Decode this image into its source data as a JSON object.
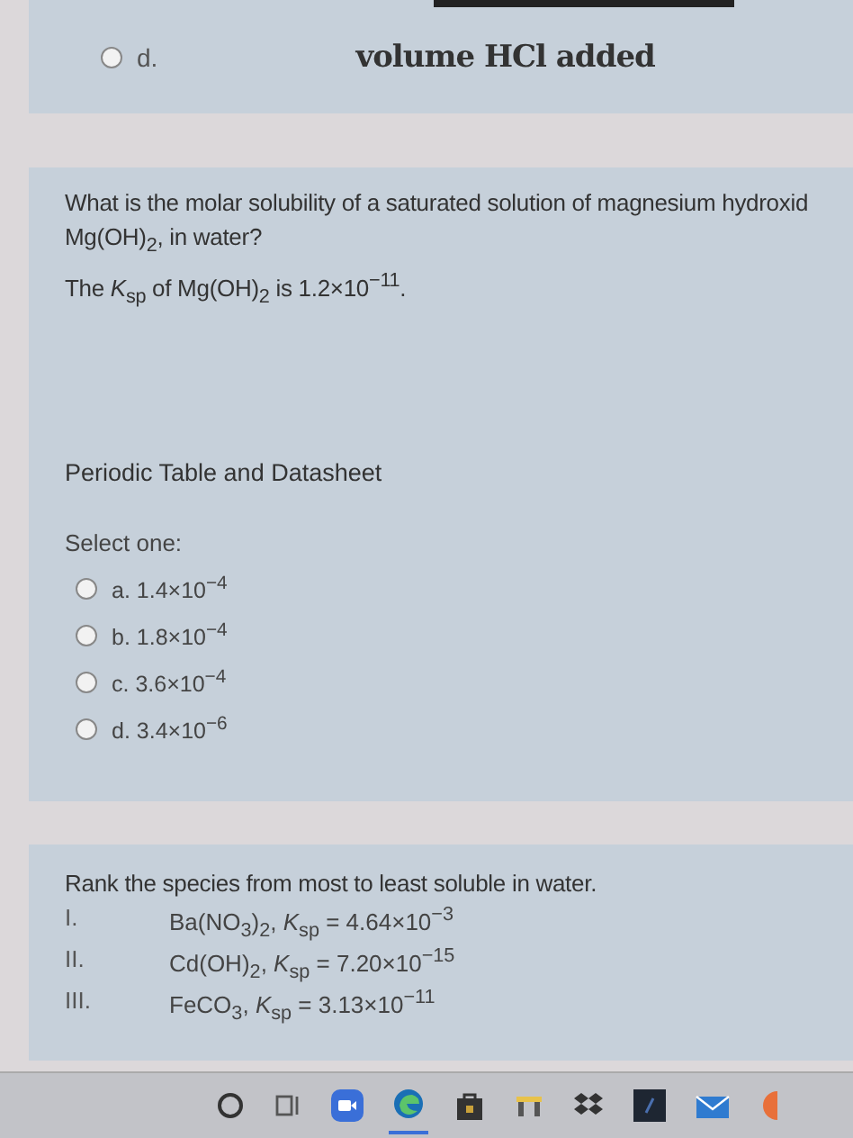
{
  "previous_question": {
    "option": {
      "label": "d.",
      "selected": false
    },
    "chart_axis_label": "volume HCl added"
  },
  "question_1": {
    "text_lines": [
      "What is the molar solubility of a saturated solution of magnesium hydroxid",
      "Mg(OH)$_{2}$, in water?",
      "The *K*$_{sp}$ of Mg(OH)$_{2}$ is 1.2×10$^{−11}$."
    ],
    "link": "Periodic Table and Datasheet",
    "prompt": "Select one:",
    "options": [
      {
        "label": "a. 1.4×10$^{−4}$",
        "selected": false
      },
      {
        "label": "b. 1.8×10$^{−4}$",
        "selected": false
      },
      {
        "label": "c. 3.6×10$^{−4}$",
        "selected": false
      },
      {
        "label": "d. 3.4×10$^{−6}$",
        "selected": false
      }
    ]
  },
  "question_2": {
    "text": "Rank the species from most to least soluble in water.",
    "items": [
      {
        "numeral": "I.",
        "text": "Ba(NO$_{3}$)$_{2}$, *K*$_{sp}$ = 4.64×10$^{−3}$"
      },
      {
        "numeral": "II.",
        "text": "Cd(OH)$_{2}$, *K*$_{sp}$ = 7.20×10$^{−15}$"
      },
      {
        "numeral": "III.",
        "text": "FeCO$_{3}$, *K*$_{sp}$ = 3.13×10$^{−11}$"
      }
    ]
  },
  "taskbar": {
    "apps": [
      {
        "kind": "search",
        "active": false
      },
      {
        "kind": "taskview",
        "active": false
      },
      {
        "kind": "video",
        "active": false
      },
      {
        "kind": "browser",
        "active": true
      },
      {
        "kind": "store",
        "active": false
      },
      {
        "kind": "folder",
        "active": false
      },
      {
        "kind": "dropbox",
        "active": false
      },
      {
        "kind": "dark",
        "active": false
      },
      {
        "kind": "mail",
        "active": false
      },
      {
        "kind": "orange",
        "active": false
      }
    ]
  }
}
